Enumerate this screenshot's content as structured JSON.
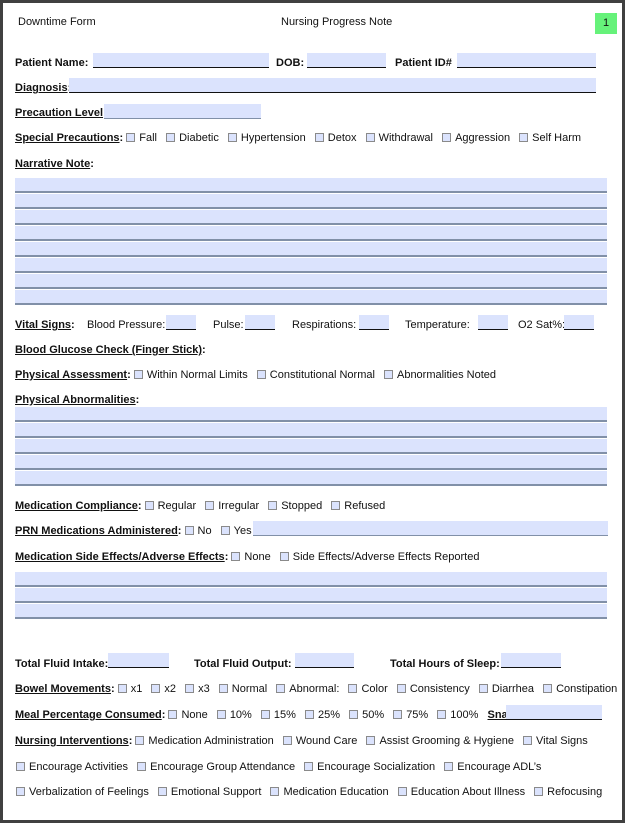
{
  "header": {
    "left": "Downtime Form",
    "center": "Nursing Progress Note",
    "page_number": "1",
    "badge_color": "#66f27a"
  },
  "patient": {
    "name_label": "Patient Name:",
    "name_value": "",
    "dob_label": "DOB:",
    "dob_value": "",
    "id_label": "Patient ID#",
    "id_value": ""
  },
  "diagnosis": {
    "label": "Diagnosis",
    "value": ""
  },
  "precaution_level": {
    "label": "Precaution Level",
    "value": ""
  },
  "special_precautions": {
    "label": "Special Precautions",
    "options": [
      "Fall",
      "Diabetic",
      "Hypertension",
      "Detox",
      "Withdrawal",
      "Aggression",
      "Self Harm"
    ]
  },
  "narrative_note": {
    "label": "Narrative Note",
    "lines": 8
  },
  "vital_signs": {
    "label": "Vital Signs",
    "fields": [
      "Blood Pressure:",
      "Pulse:",
      "Respirations:",
      "Temperature:",
      "O2 Sat%:"
    ]
  },
  "blood_glucose": {
    "label": "Blood Glucose Check (Finger Stick)"
  },
  "physical_assessment": {
    "label": "Physical Assessment",
    "options": [
      "Within Normal Limits",
      "Constitutional Normal",
      "Abnormalities Noted"
    ]
  },
  "physical_abnormalities": {
    "label": "Physical Abnormalities",
    "lines": 5
  },
  "medication_compliance": {
    "label": "Medication Compliance",
    "options": [
      "Regular",
      "Irregular",
      "Stopped",
      "Refused"
    ]
  },
  "prn_medications": {
    "label": "PRN Medications Administered",
    "options": [
      "No",
      "Yes"
    ],
    "value": ""
  },
  "side_effects": {
    "label": "Medication Side Effects/Adverse Effects",
    "options": [
      "None",
      "Side Effects/Adverse Effects Reported"
    ],
    "lines": 3
  },
  "totals": {
    "fluid_intake_label": "Total Fluid Intake:",
    "fluid_output_label": "Total Fluid Output:",
    "sleep_label": "Total Hours of Sleep:"
  },
  "bowel_movements": {
    "label": "Bowel Movements",
    "options": [
      "x1",
      "x2",
      "x3",
      "Normal",
      "Abnormal:",
      "Color",
      "Consistency",
      "Diarrhea",
      "Constipation"
    ]
  },
  "meal_percentage": {
    "label": "Meal Percentage Consumed",
    "options": [
      "None",
      "10%",
      "15%",
      "25%",
      "50%",
      "75%",
      "100%"
    ],
    "snacks_label": "Snacks"
  },
  "nursing_interventions": {
    "label": "Nursing Interventions",
    "row1": [
      "Medication Administration",
      "Wound Care",
      "Assist Grooming & Hygiene",
      "Vital Signs"
    ],
    "row2": [
      "Encourage Activities",
      "Encourage Group Attendance",
      "Encourage Socialization",
      "Encourage ADL’s"
    ],
    "row3": [
      "Verbalization of Feelings",
      "Emotional Support",
      "Medication Education",
      "Education About Illness",
      "Refocusing"
    ]
  }
}
